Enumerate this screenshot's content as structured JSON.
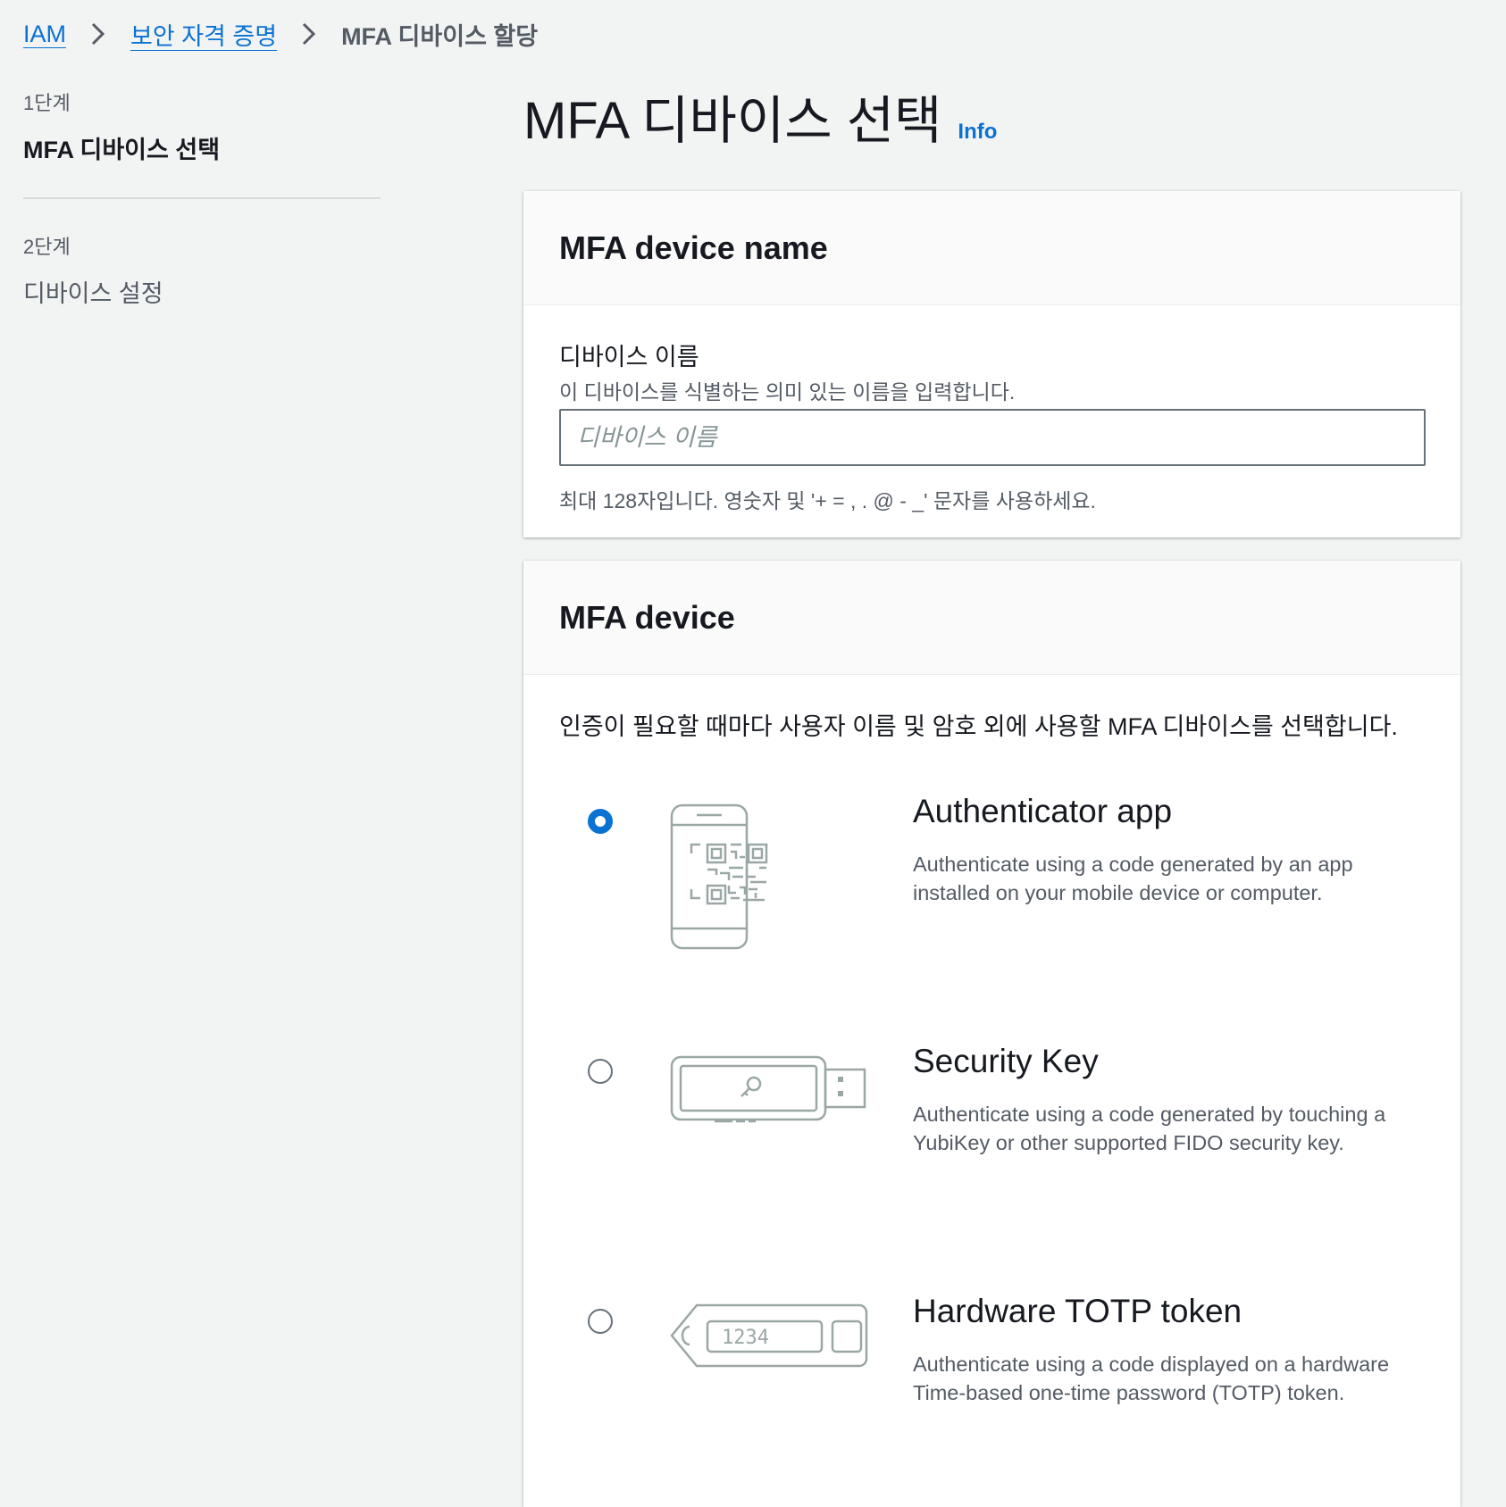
{
  "breadcrumb": {
    "root": "IAM",
    "section": "보안 자격 증명",
    "current": "MFA 디바이스 할당"
  },
  "steps": [
    {
      "number": "1단계",
      "title": "MFA 디바이스 선택",
      "active": true
    },
    {
      "number": "2단계",
      "title": "디바이스 설정",
      "active": false
    }
  ],
  "page": {
    "title": "MFA 디바이스 선택",
    "info_label": "Info"
  },
  "name_panel": {
    "title": "MFA device name",
    "label": "디바이스 이름",
    "description": "이 디바이스를 식별하는 의미 있는 이름을 입력합니다.",
    "placeholder": "디바이스 이름",
    "value": "",
    "constraint": "최대 128자입니다. 영숫자 및 '+ = , . @ - _' 문자를 사용하세요."
  },
  "device_panel": {
    "title": "MFA device",
    "intro": "인증이 필요할 때마다 사용자 이름 및 암호 외에 사용할 MFA 디바이스를 선택합니다.",
    "selected": "authenticator-app",
    "options": [
      {
        "id": "authenticator-app",
        "icon": "mobile-qr-icon",
        "title": "Authenticator app",
        "description": "Authenticate using a code generated by an app installed on your mobile device or computer."
      },
      {
        "id": "security-key",
        "icon": "usb-security-key-icon",
        "title": "Security Key",
        "description": "Authenticate using a code generated by touching a YubiKey or other supported FIDO security key."
      },
      {
        "id": "hardware-totp",
        "icon": "totp-token-icon",
        "title": "Hardware TOTP token",
        "description": "Authenticate using a code displayed on a hardware Time-based one-time password (TOTP) token.",
        "token_display": "1234"
      }
    ]
  },
  "colors": {
    "accent": "#0972d3",
    "background": "#f2f3f3",
    "illustration_stroke": "#9ba7a6"
  }
}
